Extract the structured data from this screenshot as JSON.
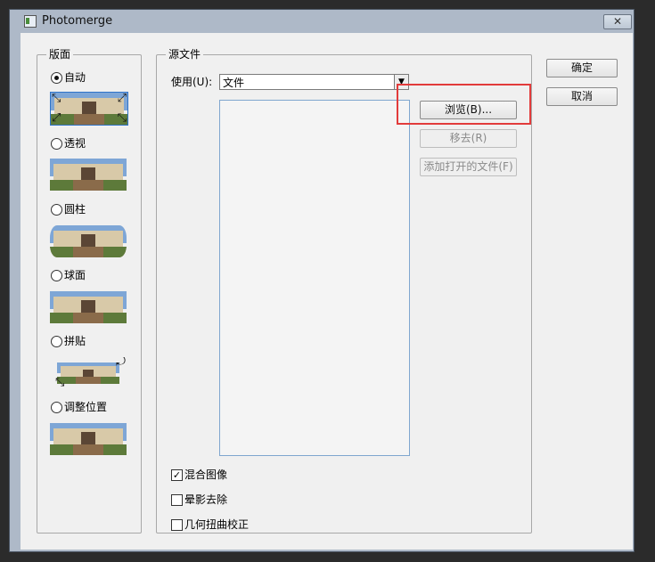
{
  "window": {
    "title": "Photomerge",
    "close_glyph": "✕"
  },
  "layout": {
    "legend": "版面",
    "options": [
      {
        "label": "自动",
        "checked": true,
        "icon": "auto-layout-icon"
      },
      {
        "label": "透视",
        "checked": false,
        "icon": "perspective-layout-icon"
      },
      {
        "label": "圆柱",
        "checked": false,
        "icon": "cylindrical-layout-icon"
      },
      {
        "label": "球面",
        "checked": false,
        "icon": "spherical-layout-icon"
      },
      {
        "label": "拼贴",
        "checked": false,
        "icon": "collage-layout-icon"
      },
      {
        "label": "调整位置",
        "checked": false,
        "icon": "reposition-layout-icon"
      }
    ]
  },
  "source": {
    "legend": "源文件",
    "use_label": "使用(U):",
    "use_value": "文件",
    "browse_label": "浏览(B)...",
    "remove_label": "移去(R)",
    "add_open_files_label": "添加打开的文件(F)",
    "options": [
      {
        "label": "混合图像",
        "checked": true
      },
      {
        "label": "晕影去除",
        "checked": false
      },
      {
        "label": "几何扭曲校正",
        "checked": false
      }
    ]
  },
  "actions": {
    "ok_label": "确定",
    "cancel_label": "取消"
  },
  "colors": {
    "highlight": "#e23b3b",
    "selection": "#2f73c8"
  }
}
